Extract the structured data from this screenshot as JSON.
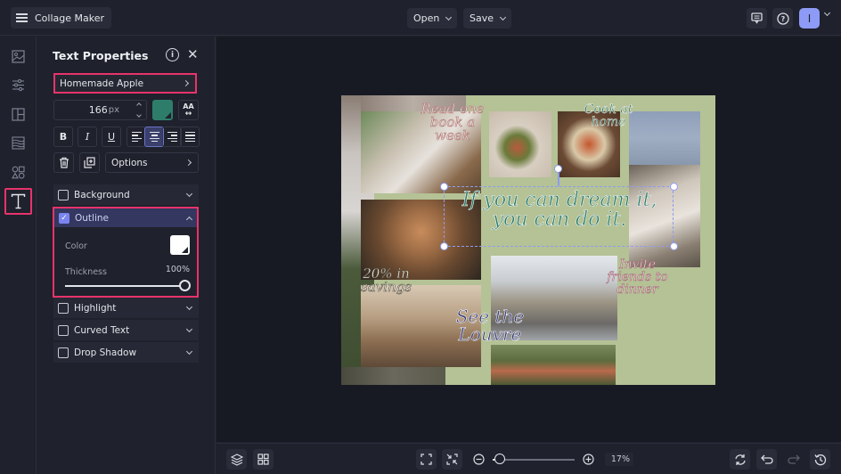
{
  "topbar": {
    "app_title": "Collage Maker",
    "open_label": "Open",
    "save_label": "Save",
    "avatar_initial": "I"
  },
  "rail": {
    "items": [
      "photos",
      "adjustments",
      "layouts",
      "backgrounds",
      "graphics",
      "text"
    ],
    "active": "text"
  },
  "panel": {
    "title": "Text Properties",
    "font_name": "Homemade Apple",
    "font_size": "166",
    "font_size_unit": "px",
    "text_color": "#2e7d6b",
    "spacing_label": "AA",
    "bold_label": "B",
    "italic_label": "I",
    "underline_label": "U",
    "alignment": "center",
    "options_label": "Options",
    "sections": {
      "background": {
        "label": "Background",
        "checked": false
      },
      "outline": {
        "label": "Outline",
        "checked": true,
        "color_label": "Color",
        "color": "#ffffff",
        "thickness_label": "Thickness",
        "thickness_value": "100%",
        "thickness_fraction": 1.0
      },
      "highlight": {
        "label": "Highlight",
        "checked": false
      },
      "curved_text": {
        "label": "Curved Text",
        "checked": false
      },
      "drop_shadow": {
        "label": "Drop Shadow",
        "checked": false
      }
    }
  },
  "canvas": {
    "background_color": "#b4c296",
    "texts": {
      "read_book": "Read one book a week",
      "cook_home": "Cook at home",
      "dream": "If you can dream it, you can do it.",
      "savings": "20% in savings",
      "louvre": "See the Louvre",
      "invite": "Invite friends to dinner"
    }
  },
  "bottombar": {
    "zoom_value": "17%",
    "zoom_fraction": 0.17
  },
  "colors": {
    "accent_highlight": "#e8336b",
    "active_blue": "#7b85f0",
    "avatar_bg": "#8d9bf6"
  }
}
